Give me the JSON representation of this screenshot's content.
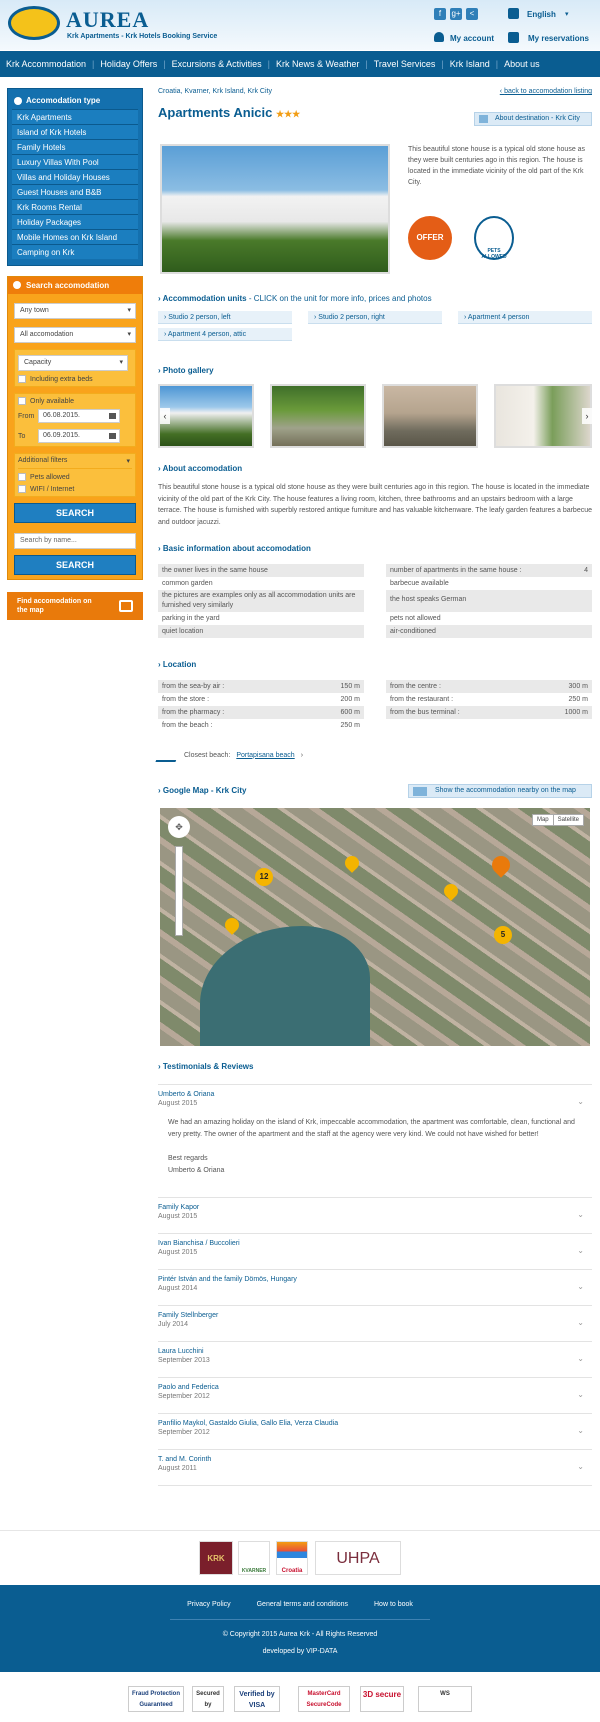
{
  "header": {
    "logo": "AUREA",
    "tagline": "Krk Apartments - Krk Hotels Booking Service",
    "language": "English",
    "my_account": "My account",
    "my_reservations": "My reservations",
    "social": [
      "f",
      "g+",
      "<"
    ]
  },
  "nav": [
    "Krk Accommodation",
    "Holiday Offers",
    "Excursions & Activities",
    "Krk News & Weather",
    "Travel Services",
    "Krk Island",
    "About us"
  ],
  "sidebar": {
    "type_title": "Accomodation type",
    "types": [
      "Krk Apartments",
      "Island of Krk Hotels",
      "Family Hotels",
      "Luxury Villas With Pool",
      "Villas and Holiday Houses",
      "Guest Houses and B&B",
      "Krk Rooms Rental",
      "Holiday Packages",
      "Mobile Homes on Krk Island",
      "Camping on Krk"
    ],
    "search_title": "Search accomodation",
    "town": "Any town",
    "accom": "All accomodation",
    "capacity": "Capacity",
    "extra_beds": "Including extra beds",
    "only_available": "Only available",
    "from_label": "From",
    "from_date": "06.08.2015.",
    "to_label": "To",
    "to_date": "06.09.2015.",
    "filters_title": "Additional filters",
    "pets": "Pets allowed",
    "wifi": "WIFI / Internet",
    "search_btn": "SEARCH",
    "name_placeholder": "Search by name...",
    "search_btn2": "SEARCH",
    "map_find": "Find accomodation on the map"
  },
  "main": {
    "breadcrumb": "Croatia, Kvarner, Krk Island, Krk City",
    "back_link": "back to accomodation listing",
    "title": "Apartments Anicic",
    "stars": "★★★",
    "about_dest": "About destination - Krk City",
    "short_desc": "This beautiful stone house is a typical old stone house as they were built centuries ago in this region. The house is located in the immediate vicinity of the old part of the Krk City.",
    "offer_badge": "OFFER",
    "pets_badge": "PETS ALLOWED",
    "units_title": "Accommodation units",
    "units_note": "- CLICK on the unit for more info, prices and photos",
    "units": [
      "Studio 2 person, left",
      "Studio 2 person, right",
      "Apartment 4 person",
      "Apartment 4 person, attic"
    ],
    "gallery_title": "Photo gallery",
    "about_title": "About accomodation",
    "about_text": "This beautiful stone house is a typical old stone house as they were built centuries ago in this region. The house is located in the immediate vicinity of the old part of the Krk City. The house features a living room, kitchen, three bathrooms and an upstairs bedroom with a large terrace. The house is furnished with superbly restored antique furniture and has valuable kitchenware. The leafy garden features a barbecue and outdoor jacuzzi.",
    "basic_title": "Basic information about accomodation",
    "basic_left": [
      "the owner lives in the same house",
      "common garden",
      "the pictures are examples only as all accommodation units are furnished very similarly",
      "parking in the yard",
      "quiet location"
    ],
    "basic_right_num_label": "number of apartments in the same house :",
    "basic_right_num": "4",
    "basic_right": [
      "barbecue available",
      "the host speaks German",
      "pets not allowed",
      "air-conditioned"
    ],
    "loc_title": "Location",
    "loc_left": [
      {
        "k": "from the sea-by air :",
        "v": "150 m"
      },
      {
        "k": "from the store :",
        "v": "200 m"
      },
      {
        "k": "from the pharmacy :",
        "v": "600 m"
      },
      {
        "k": "from the beach :",
        "v": "250 m"
      }
    ],
    "loc_right": [
      {
        "k": "from the centre :",
        "v": "300 m"
      },
      {
        "k": "from the restaurant :",
        "v": "250 m"
      },
      {
        "k": "from the bus terminal :",
        "v": "1000 m"
      }
    ],
    "closest_label": "Closest beach:",
    "closest_link": "Portapisana beach",
    "gmap_title": "Google Map - Krk City",
    "gmap_btn": "Show the accommodation nearby on the map",
    "map_type": [
      "Map",
      "Satellite"
    ],
    "clusters": [
      "12",
      "5"
    ],
    "test_title": "Testimonials & Reviews",
    "testimonials": [
      {
        "name": "Umberto & Oriana",
        "date": "August 2015",
        "text": "We had an amazing holiday on the island of Krk, impeccable accommodation, the apartment was comfortable, clean, functional and very pretty. The owner of the apartment and the staff at the agency were very kind. We could not have wished for better!",
        "regards": "Best regards",
        "sign": "Umberto & Oriana"
      },
      {
        "name": "Family Kapor",
        "date": "August 2015"
      },
      {
        "name": "Ivan Bianchisa / Buccolieri",
        "date": "August 2015"
      },
      {
        "name": "Pintér István and the family Dömös, Hungary",
        "date": "August 2014"
      },
      {
        "name": "Family Stellnberger",
        "date": "July 2014"
      },
      {
        "name": "Laura Lucchini",
        "date": "September 2013"
      },
      {
        "name": "Paolo and Federica",
        "date": "September 2012"
      },
      {
        "name": "Panfilio Maykol, Gastaldo Giulia, Gallo Elia, Verza Claudia",
        "date": "September 2012"
      },
      {
        "name": "T. and M. Corinth",
        "date": "August 2011"
      }
    ]
  },
  "partners": [
    "KRK",
    "KVARNER",
    "Croatia",
    "UHPA"
  ],
  "footer": {
    "links": [
      "Privacy Policy",
      "General terms and conditions",
      "How to book"
    ],
    "copyright": "© Copyright 2015 Aurea Krk - All Rights Reserved",
    "developed": "developed by VIP-DATA"
  },
  "seals": [
    "Fraud Protection Guaranteed",
    "Secured by",
    "Verified by VISA",
    "MasterCard SecureCode",
    "3D secure",
    "WS"
  ]
}
